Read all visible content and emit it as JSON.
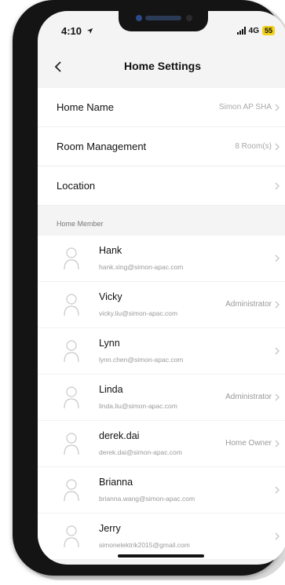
{
  "status_bar": {
    "time": "4:10",
    "network": "4G",
    "battery": "55"
  },
  "header": {
    "title": "Home Settings"
  },
  "settings": [
    {
      "label": "Home Name",
      "value": "Simon AP SHA"
    },
    {
      "label": "Room Management",
      "value": "8 Room(s)"
    },
    {
      "label": "Location",
      "value": ""
    }
  ],
  "members_section": {
    "title": "Home Member"
  },
  "members": [
    {
      "name": "Hank",
      "email": "hank.xing@simon-apac.com",
      "role": ""
    },
    {
      "name": "Vicky",
      "email": "vicky.liu@simon-apac.com",
      "role": "Administrator"
    },
    {
      "name": "Lynn",
      "email": "lynn.chen@simon-apac.com",
      "role": ""
    },
    {
      "name": "Linda",
      "email": "linda.liu@simon-apac.com",
      "role": "Administrator"
    },
    {
      "name": "derek.dai",
      "email": "derek.dai@simon-apac.com",
      "role": "Home Owner"
    },
    {
      "name": "Brianna",
      "email": "brianna.wang@simon-apac.com",
      "role": ""
    },
    {
      "name": "Jerry",
      "email": "simonelektrik2015@gmail.com",
      "role": ""
    }
  ],
  "colors": {
    "battery_badge": "#f2d21c",
    "background": "#f4f4f4"
  }
}
